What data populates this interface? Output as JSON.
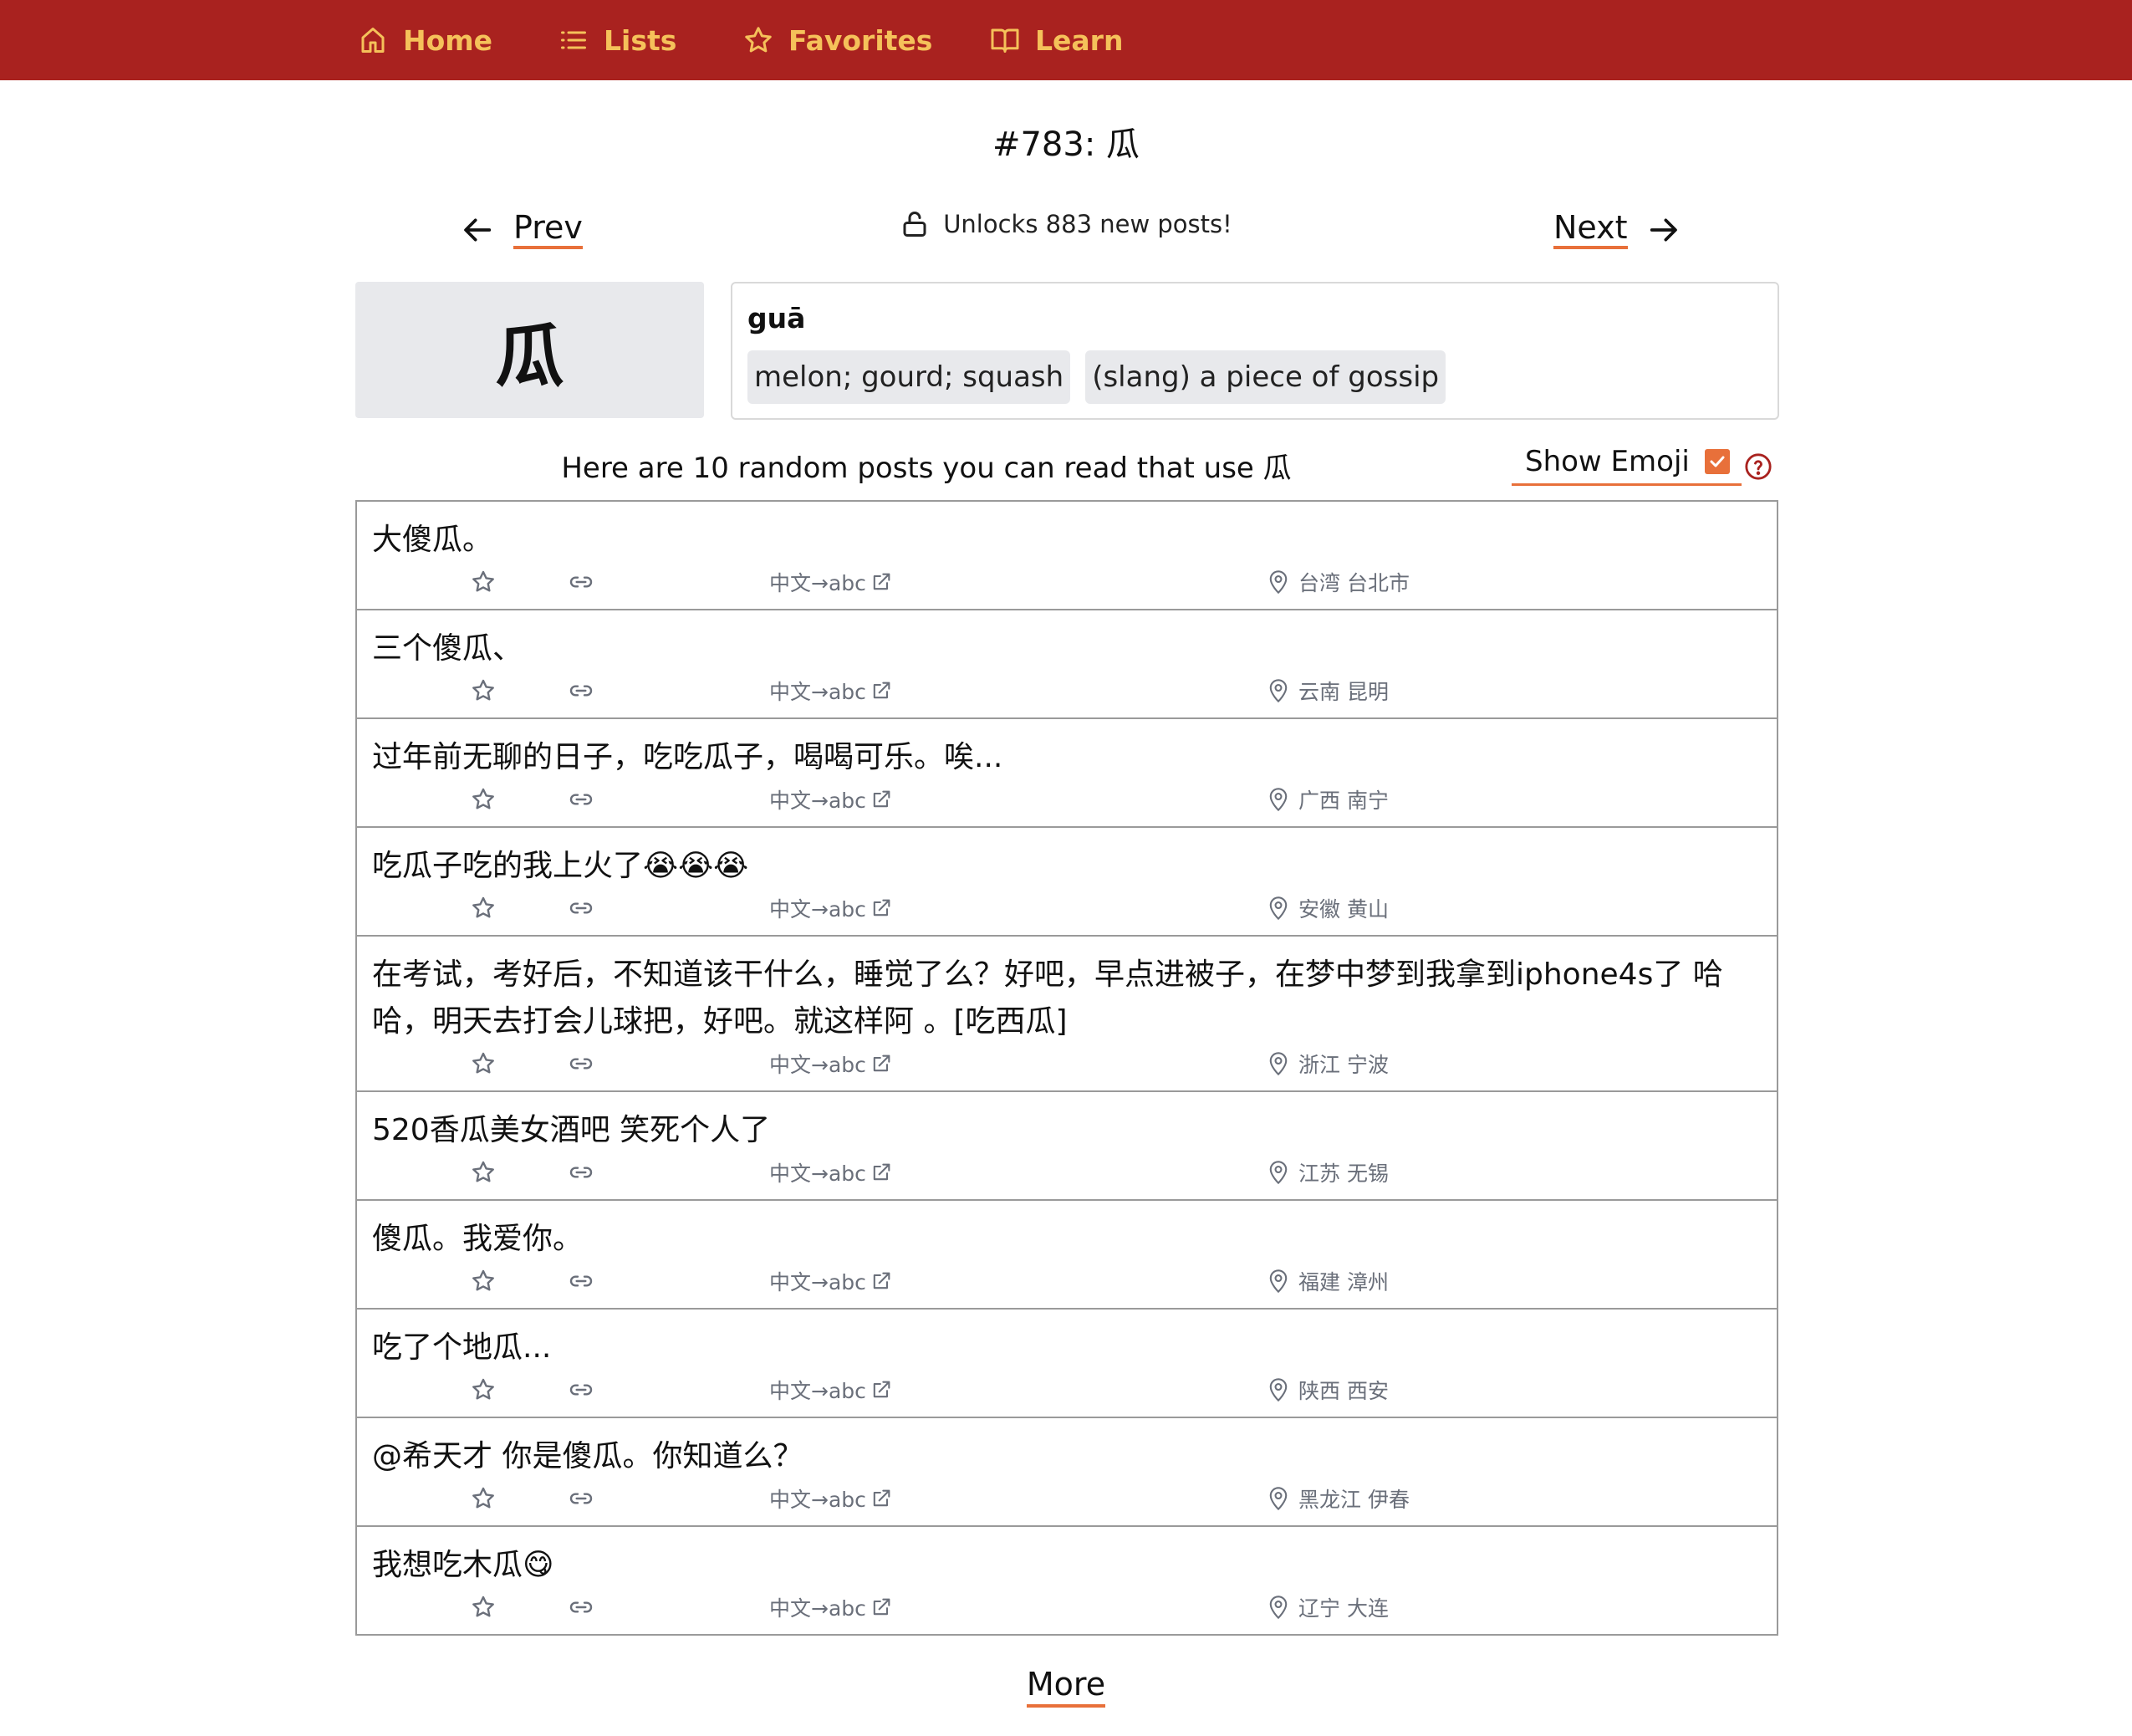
{
  "nav": {
    "items": [
      {
        "label": "Home",
        "icon": "home-icon"
      },
      {
        "label": "Lists",
        "icon": "list-icon"
      },
      {
        "label": "Favorites",
        "icon": "star-icon"
      },
      {
        "label": "Learn",
        "icon": "book-icon"
      }
    ]
  },
  "page_title": "#783: 瓜",
  "pager": {
    "prev_label": "Prev",
    "next_label": "Next",
    "unlock_text": "Unlocks 883 new posts!"
  },
  "word": {
    "character": "瓜",
    "pinyin": "guā",
    "definitions": [
      "melon; gourd; squash",
      "(slang) a piece of gossip"
    ]
  },
  "intro_text": "Here are 10 random posts you can read that use 瓜",
  "emoji_toggle": {
    "label": "Show Emoji",
    "checked": true
  },
  "post_meta": {
    "translate_label": "中文→abc"
  },
  "posts": [
    {
      "text": "大傻瓜。",
      "location": "台湾 台北市"
    },
    {
      "text": "三个傻瓜、",
      "location": "云南 昆明"
    },
    {
      "text": "过年前无聊的日子，吃吃瓜子，喝喝可乐。唉...",
      "location": "广西 南宁"
    },
    {
      "text": "吃瓜子吃的我上火了😭😭😭",
      "location": "安徽 黄山"
    },
    {
      "text": "在考试，考好后，不知道该干什么，睡觉了么？好吧，早点进被子，在梦中梦到我拿到iphone4s了 哈哈，明天去打会儿球把，好吧。就这样阿 。[吃西瓜]",
      "location": "浙江 宁波"
    },
    {
      "text": "520香瓜美女酒吧 笑死个人了",
      "location": "江苏 无锡"
    },
    {
      "text": "傻瓜。我爱你。",
      "location": "福建 漳州"
    },
    {
      "text": "吃了个地瓜...",
      "location": "陕西 西安"
    },
    {
      "text": "@希天才 你是傻瓜。你知道么？",
      "location": "黑龙江 伊春"
    },
    {
      "text": "我想吃木瓜😋",
      "location": "辽宁 大连"
    }
  ],
  "more_label": "More",
  "colors": {
    "nav_bg": "#a9221f",
    "nav_text": "#f5c15a",
    "accent": "#e8703a",
    "meta_text": "#6a6f7a"
  }
}
